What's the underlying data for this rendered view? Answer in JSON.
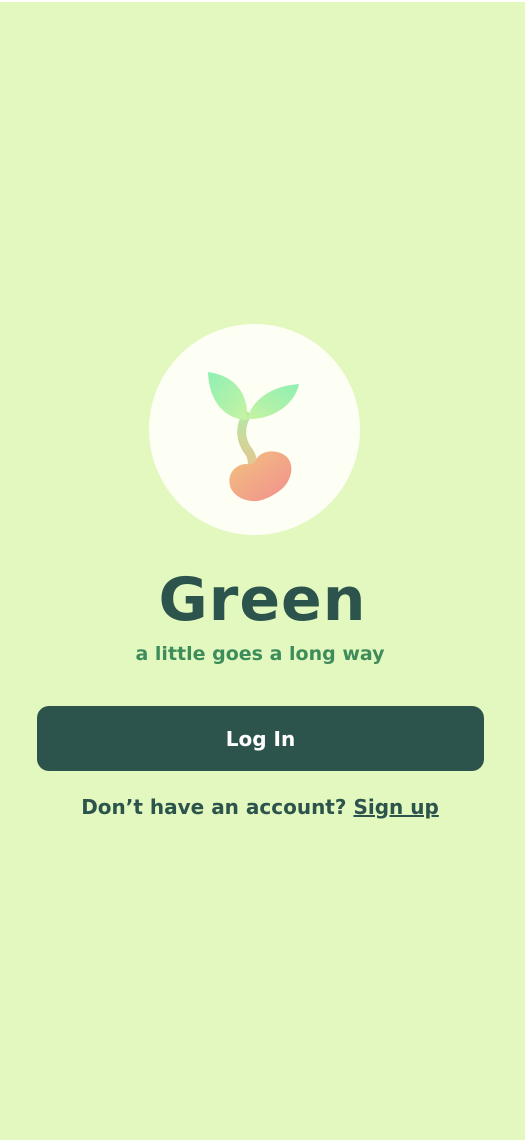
{
  "app": {
    "title": "Green",
    "tagline": "a little goes a long way"
  },
  "logo": {
    "icon": "sprout-heart-icon",
    "leaf_colors": [
      "#8ff0b4",
      "#c6f2a2"
    ],
    "heart_colors": [
      "#f2c27e",
      "#f28f8f"
    ]
  },
  "actions": {
    "login_label": "Log In",
    "signup_prompt": "Don’t have an account?",
    "signup_link_label": "Sign up"
  },
  "colors": {
    "background": "#e2f8be",
    "primary": "#2d544c",
    "tagline": "#3e8c5c",
    "logo_circle": "#fdfff4"
  }
}
